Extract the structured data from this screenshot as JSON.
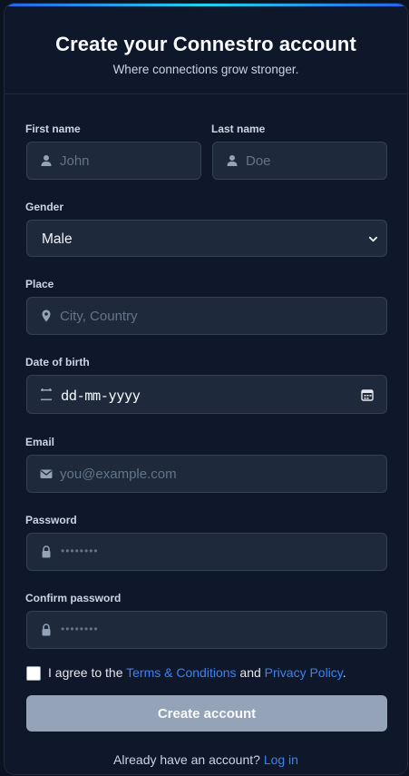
{
  "header": {
    "title": "Create your Connestro account",
    "subtitle": "Where connections grow stronger."
  },
  "form": {
    "first_name": {
      "label": "First name",
      "placeholder": "John",
      "icon": "user-icon"
    },
    "last_name": {
      "label": "Last name",
      "placeholder": "Doe",
      "icon": "user-icon"
    },
    "gender": {
      "label": "Gender",
      "selected": "Male",
      "icon": "chevron-down-icon"
    },
    "place": {
      "label": "Place",
      "placeholder": "City, Country",
      "icon": "map-pin-icon"
    },
    "dob": {
      "label": "Date of birth",
      "value": "dd-mm-yyyy",
      "icon": "calendar-icon"
    },
    "email": {
      "label": "Email",
      "placeholder": "you@example.com",
      "icon": "envelope-icon"
    },
    "password": {
      "label": "Password",
      "placeholder": "••••••••",
      "icon": "lock-icon"
    },
    "confirm_password": {
      "label": "Confirm password",
      "placeholder": "••••••••",
      "icon": "lock-icon"
    }
  },
  "agree": {
    "prefix": "I agree to the ",
    "terms": "Terms & Conditions",
    "middle": " and ",
    "privacy": "Privacy Policy",
    "suffix": "."
  },
  "submit_label": "Create account",
  "footer": {
    "text": "Already have an account? ",
    "link": "Log in"
  },
  "colors": {
    "background": "#0f172a",
    "field": "#1e293b",
    "accent": "#3b82f6",
    "button_disabled": "#94a3b8"
  }
}
